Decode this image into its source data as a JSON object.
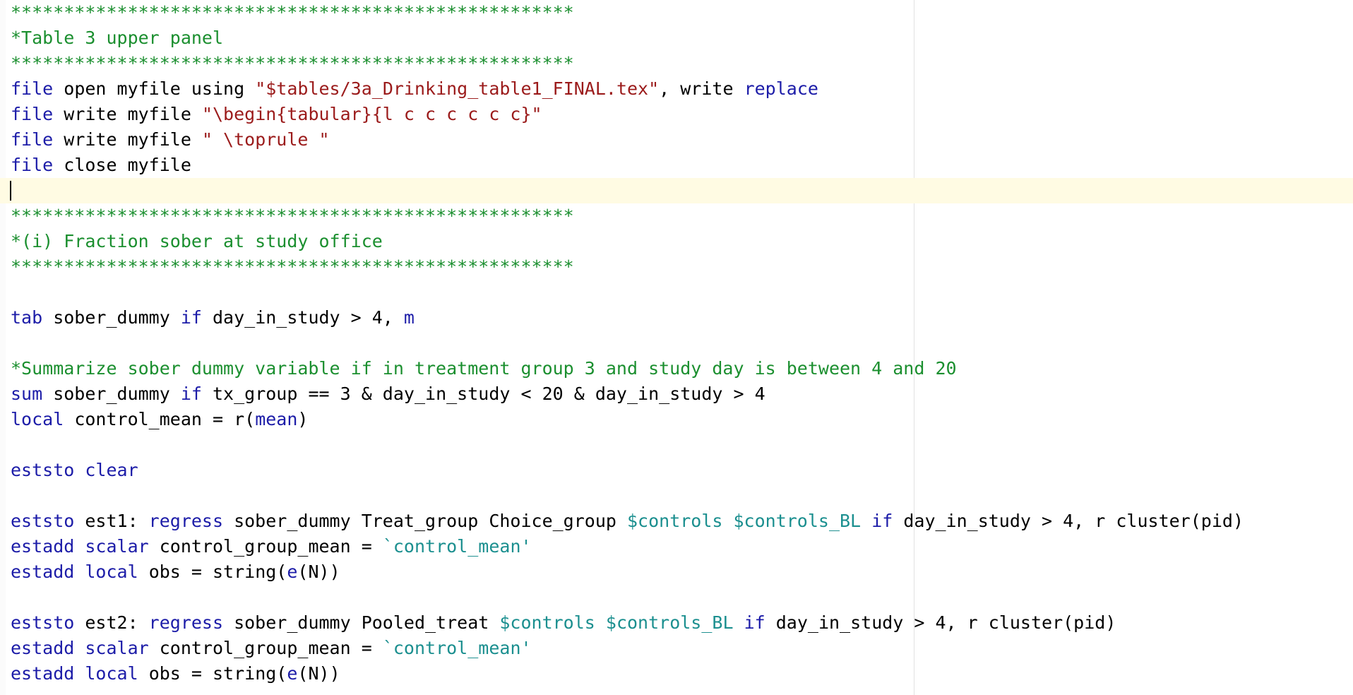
{
  "colors": {
    "comment": "#1b8f2f",
    "keyword": "#1c1ca8",
    "string": "#9b1b1b",
    "macro": "#1b8f8f",
    "plain": "#000000",
    "current_line": "#fffbe3"
  },
  "cursor_line": 7,
  "lines": [
    [
      {
        "t": "*****************************************************",
        "c": "comment"
      }
    ],
    [
      {
        "t": "*Table 3 upper panel",
        "c": "comment"
      }
    ],
    [
      {
        "t": "*****************************************************",
        "c": "comment"
      }
    ],
    [
      {
        "t": "file",
        "c": "keyword"
      },
      {
        "t": " open myfile using ",
        "c": "plain"
      },
      {
        "t": "\"$tables/3a_Drinking_table1_FINAL.tex\"",
        "c": "string"
      },
      {
        "t": ", write ",
        "c": "plain"
      },
      {
        "t": "replace",
        "c": "keyword"
      }
    ],
    [
      {
        "t": "file",
        "c": "keyword"
      },
      {
        "t": " write myfile ",
        "c": "plain"
      },
      {
        "t": "\"\\begin{tabular}{l c c c c c c}\"",
        "c": "string"
      }
    ],
    [
      {
        "t": "file",
        "c": "keyword"
      },
      {
        "t": " write myfile ",
        "c": "plain"
      },
      {
        "t": "\" \\toprule \"",
        "c": "string"
      }
    ],
    [
      {
        "t": "file",
        "c": "keyword"
      },
      {
        "t": " close myfile",
        "c": "plain"
      }
    ],
    [],
    [
      {
        "t": "*****************************************************",
        "c": "comment"
      }
    ],
    [
      {
        "t": "*(i) Fraction sober at study office",
        "c": "comment"
      }
    ],
    [
      {
        "t": "*****************************************************",
        "c": "comment"
      }
    ],
    [],
    [
      {
        "t": "tab",
        "c": "keyword"
      },
      {
        "t": " sober_dummy ",
        "c": "plain"
      },
      {
        "t": "if",
        "c": "keyword"
      },
      {
        "t": " day_in_study > 4, ",
        "c": "plain"
      },
      {
        "t": "m",
        "c": "keyword"
      }
    ],
    [],
    [
      {
        "t": "*Summarize sober dummy variable if in treatment group 3 and study day is between 4 and 20",
        "c": "comment"
      }
    ],
    [
      {
        "t": "sum",
        "c": "keyword"
      },
      {
        "t": " sober_dummy ",
        "c": "plain"
      },
      {
        "t": "if",
        "c": "keyword"
      },
      {
        "t": " tx_group == 3 & day_in_study < 20 & day_in_study > 4",
        "c": "plain"
      }
    ],
    [
      {
        "t": "local",
        "c": "keyword"
      },
      {
        "t": " control_mean = r(",
        "c": "plain"
      },
      {
        "t": "mean",
        "c": "keyword"
      },
      {
        "t": ")",
        "c": "plain"
      }
    ],
    [],
    [
      {
        "t": "eststo",
        "c": "keyword"
      },
      {
        "t": " ",
        "c": "plain"
      },
      {
        "t": "clear",
        "c": "keyword"
      }
    ],
    [],
    [
      {
        "t": "eststo",
        "c": "keyword"
      },
      {
        "t": " est1: ",
        "c": "plain"
      },
      {
        "t": "regress",
        "c": "keyword"
      },
      {
        "t": " sober_dummy Treat_group Choice_group ",
        "c": "plain"
      },
      {
        "t": "$controls $controls_BL",
        "c": "macro"
      },
      {
        "t": " ",
        "c": "plain"
      },
      {
        "t": "if",
        "c": "keyword"
      },
      {
        "t": " day_in_study > 4, r cluster(pid)",
        "c": "plain"
      }
    ],
    [
      {
        "t": "estadd",
        "c": "keyword"
      },
      {
        "t": " ",
        "c": "plain"
      },
      {
        "t": "scalar",
        "c": "keyword"
      },
      {
        "t": " control_group_mean = ",
        "c": "plain"
      },
      {
        "t": "`control_mean'",
        "c": "macro"
      }
    ],
    [
      {
        "t": "estadd",
        "c": "keyword"
      },
      {
        "t": " ",
        "c": "plain"
      },
      {
        "t": "local",
        "c": "keyword"
      },
      {
        "t": " obs = string(",
        "c": "plain"
      },
      {
        "t": "e",
        "c": "keyword"
      },
      {
        "t": "(N))",
        "c": "plain"
      }
    ],
    [],
    [
      {
        "t": "eststo",
        "c": "keyword"
      },
      {
        "t": " est2: ",
        "c": "plain"
      },
      {
        "t": "regress",
        "c": "keyword"
      },
      {
        "t": " sober_dummy Pooled_treat ",
        "c": "plain"
      },
      {
        "t": "$controls $controls_BL",
        "c": "macro"
      },
      {
        "t": " ",
        "c": "plain"
      },
      {
        "t": "if",
        "c": "keyword"
      },
      {
        "t": " day_in_study > 4, r cluster(pid)",
        "c": "plain"
      }
    ],
    [
      {
        "t": "estadd",
        "c": "keyword"
      },
      {
        "t": " ",
        "c": "plain"
      },
      {
        "t": "scalar",
        "c": "keyword"
      },
      {
        "t": " control_group_mean = ",
        "c": "plain"
      },
      {
        "t": "`control_mean'",
        "c": "macro"
      }
    ],
    [
      {
        "t": "estadd",
        "c": "keyword"
      },
      {
        "t": " ",
        "c": "plain"
      },
      {
        "t": "local",
        "c": "keyword"
      },
      {
        "t": " obs = string(",
        "c": "plain"
      },
      {
        "t": "e",
        "c": "keyword"
      },
      {
        "t": "(N))",
        "c": "plain"
      }
    ]
  ]
}
